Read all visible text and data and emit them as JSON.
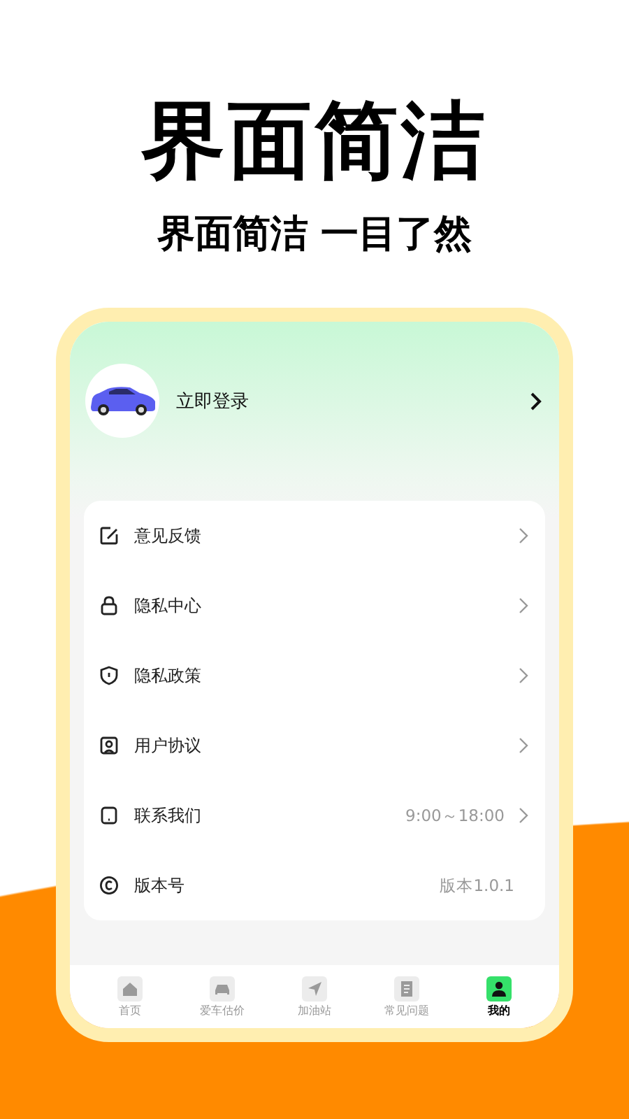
{
  "headline": "界面简洁",
  "subtitle": "界面简洁 一目了然",
  "profile": {
    "login_label": "立即登录"
  },
  "menu": [
    {
      "label": "意见反馈",
      "has_arrow": true
    },
    {
      "label": "隐私中心",
      "has_arrow": true
    },
    {
      "label": "隐私政策",
      "has_arrow": true
    },
    {
      "label": "用户协议",
      "has_arrow": true
    },
    {
      "label": "联系我们",
      "value": "9:00～18:00",
      "has_arrow": true
    },
    {
      "label": "版本号",
      "value": "版本1.0.1",
      "has_arrow": false
    }
  ],
  "tabs": [
    {
      "label": "首页",
      "selected": false
    },
    {
      "label": "爱车估价",
      "selected": false
    },
    {
      "label": "加油站",
      "selected": false
    },
    {
      "label": "常见问题",
      "selected": false
    },
    {
      "label": "我的",
      "selected": true
    }
  ]
}
